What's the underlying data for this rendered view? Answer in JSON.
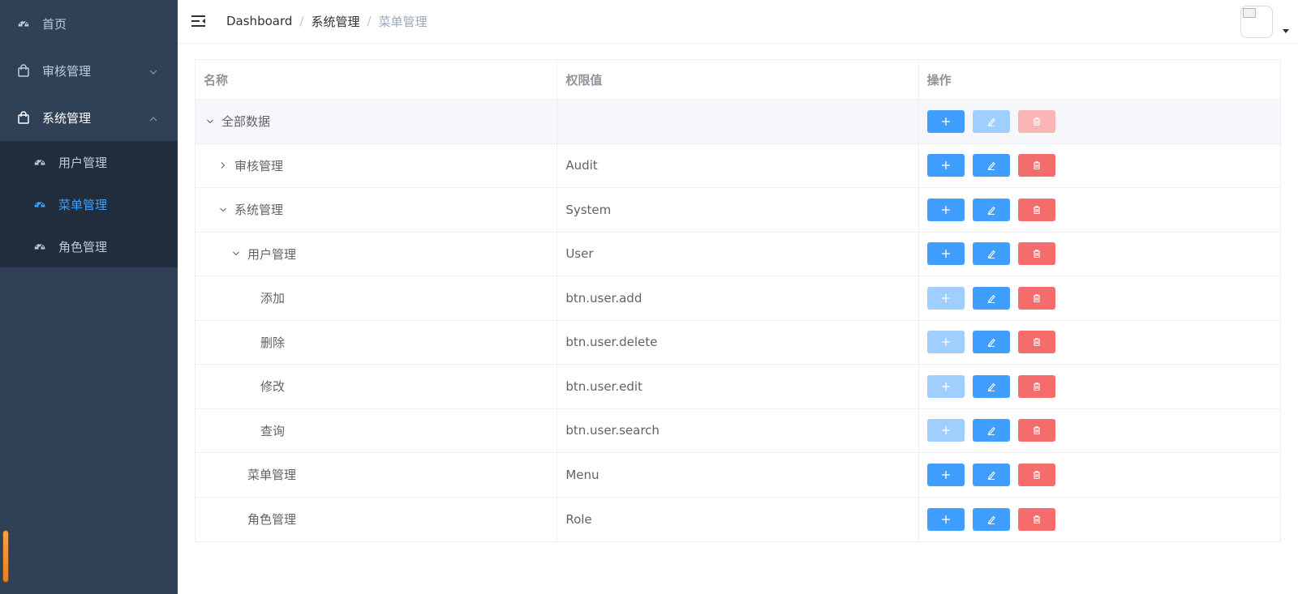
{
  "sidebar": {
    "items": [
      {
        "label": "首页",
        "icon": "dashboard-icon"
      },
      {
        "label": "审核管理",
        "icon": "bag-icon"
      },
      {
        "label": "系统管理",
        "icon": "bag-icon"
      }
    ],
    "submenu": [
      {
        "label": "用户管理",
        "icon": "dashboard-icon",
        "active": false
      },
      {
        "label": "菜单管理",
        "icon": "dashboard-icon",
        "active": true
      },
      {
        "label": "角色管理",
        "icon": "dashboard-icon",
        "active": false
      }
    ]
  },
  "header": {
    "breadcrumb": [
      "Dashboard",
      "系统管理",
      "菜单管理"
    ]
  },
  "table": {
    "columns": [
      "名称",
      "权限值",
      "操作"
    ],
    "rows": [
      {
        "name": "全部数据",
        "value": "",
        "level": 0,
        "expand": "open",
        "add_disabled": false,
        "edit_disabled": true,
        "del_disabled": true
      },
      {
        "name": "审核管理",
        "value": "Audit",
        "level": 1,
        "expand": "closed",
        "add_disabled": false,
        "edit_disabled": false,
        "del_disabled": false
      },
      {
        "name": "系统管理",
        "value": "System",
        "level": 1,
        "expand": "open",
        "add_disabled": false,
        "edit_disabled": false,
        "del_disabled": false
      },
      {
        "name": "用户管理",
        "value": "User",
        "level": 2,
        "expand": "open",
        "add_disabled": false,
        "edit_disabled": false,
        "del_disabled": false
      },
      {
        "name": "添加",
        "value": "btn.user.add",
        "level": 3,
        "expand": "none",
        "add_disabled": true,
        "edit_disabled": false,
        "del_disabled": false
      },
      {
        "name": "删除",
        "value": "btn.user.delete",
        "level": 3,
        "expand": "none",
        "add_disabled": true,
        "edit_disabled": false,
        "del_disabled": false
      },
      {
        "name": "修改",
        "value": "btn.user.edit",
        "level": 3,
        "expand": "none",
        "add_disabled": true,
        "edit_disabled": false,
        "del_disabled": false
      },
      {
        "name": "查询",
        "value": "btn.user.search",
        "level": 3,
        "expand": "none",
        "add_disabled": true,
        "edit_disabled": false,
        "del_disabled": false
      },
      {
        "name": "菜单管理",
        "value": "Menu",
        "level": 2,
        "expand": "none",
        "add_disabled": false,
        "edit_disabled": false,
        "del_disabled": false
      },
      {
        "name": "角色管理",
        "value": "Role",
        "level": 2,
        "expand": "none",
        "add_disabled": false,
        "edit_disabled": false,
        "del_disabled": false
      }
    ]
  },
  "colors": {
    "sidebar_bg": "#304156",
    "submenu_bg": "#1f2d3d",
    "primary": "#409eff",
    "danger": "#f56c6c"
  }
}
